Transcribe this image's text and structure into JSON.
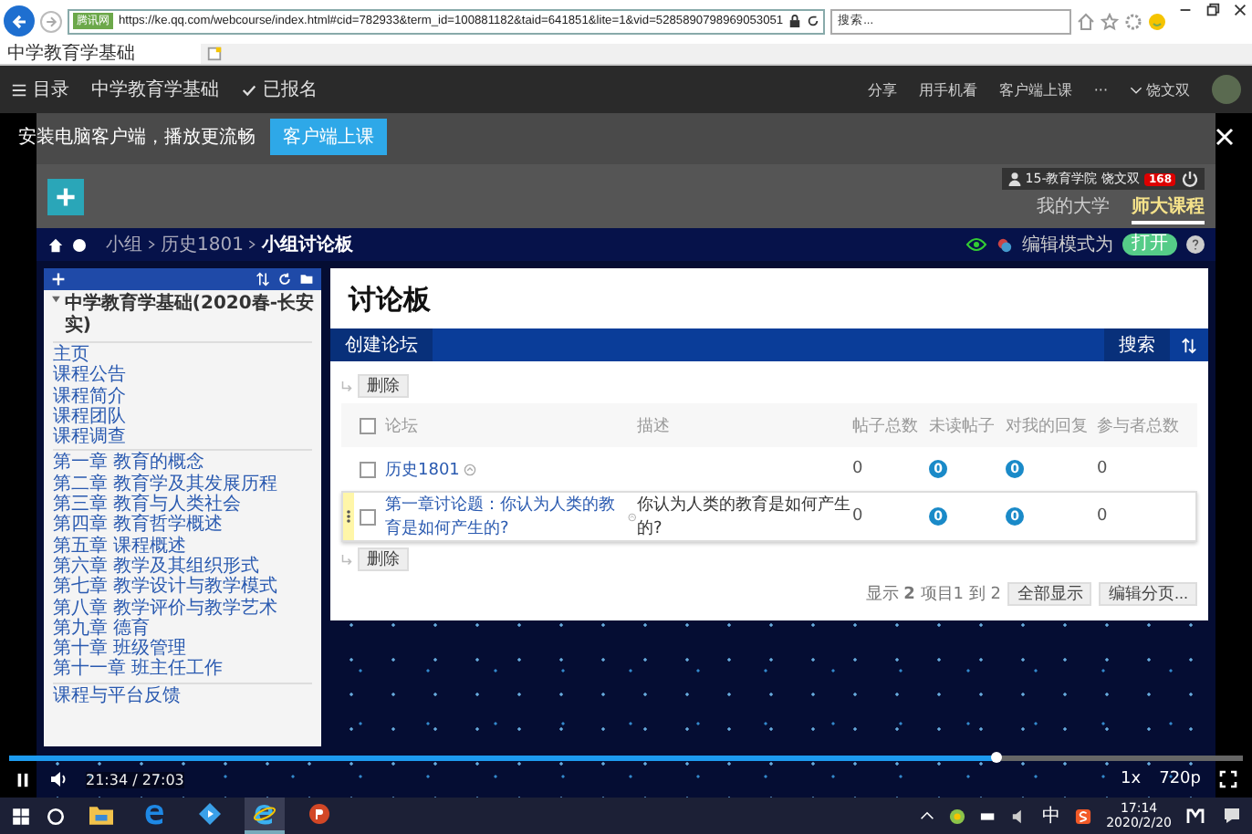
{
  "browser": {
    "url": "https://ke.qq.com/webcourse/index.html#cid=782933&term_id=100881182&taid=641851&lite=1&vid=5285890798969053051",
    "site_tag": "腾讯网",
    "search": {
      "placeholder": "搜索..."
    },
    "tabs": [
      {
        "label": "中学教育学基础",
        "selected": true
      }
    ]
  },
  "site_bar": {
    "menu": "目录",
    "course": "中学教育学基础",
    "enrolled": "已报名",
    "actions": [
      "分享",
      "用手机看",
      "客户端上课",
      "···"
    ],
    "user": "饶文双"
  },
  "banner": {
    "text": "安装电脑客户端，播放更流畅",
    "button": "客户端上课"
  },
  "lms": {
    "user": "15-教育学院 饶文双",
    "badge": "168",
    "tabs": [
      {
        "label": "我的大学",
        "selected": false
      },
      {
        "label": "师大课程",
        "selected": true
      }
    ],
    "breadcrumb": [
      "小组",
      "历史1801",
      "小组讨论板"
    ],
    "edit_mode": {
      "label": "编辑模式为",
      "toggle": "打开",
      "on": true
    },
    "sidebar": {
      "title": "中学教育学基础(2020春-长安实)",
      "groups": [
        [
          "主页",
          "课程公告",
          "课程简介",
          "课程团队",
          "课程调查"
        ],
        [
          "第一章 教育的概念",
          "第二章 教育学及其发展历程",
          "第三章 教育与人类社会",
          "第四章 教育哲学概述",
          "第五章 课程概述",
          "第六章 教学及其组织形式",
          "第七章 教学设计与教学模式",
          "第八章 教学评价与教学艺术",
          "第九章 德育",
          "第十章 班级管理",
          "第十一章 班主任工作"
        ],
        [
          "课程与平台反馈"
        ]
      ]
    },
    "page": {
      "title": "讨论板",
      "create": "创建论坛",
      "search": "搜索",
      "delete_top": "删除",
      "header_checked": false,
      "columns": [
        "论坛",
        "描述",
        "帖子总数",
        "未读帖子",
        "对我的回复",
        "参与者总数"
      ],
      "rows": [
        {
          "forum": "历史1801",
          "posts": "0",
          "unread": "0",
          "replies": "0",
          "participants": "0",
          "checked": false,
          "selected": false
        },
        {
          "forum": "第一章讨论题：你认为人类的教育是如何产生的?",
          "description": "你认为人类的教育是如何产生的?",
          "posts": "0",
          "unread": "0",
          "replies": "0",
          "participants": "0",
          "checked": false,
          "selected": true
        }
      ],
      "delete_bottom": "删除",
      "summary": "显示 **2** 项目1 到 2",
      "show_all": "全部显示",
      "edit_paging": "编辑分页..."
    }
  },
  "player": {
    "time": "21:34 / 27:03",
    "level": 0.8,
    "speed": "1x",
    "quality": "720p"
  },
  "taskbar": {
    "apps": [
      {
        "kind": "folder",
        "selected": false
      },
      {
        "kind": "edge",
        "selected": false
      },
      {
        "kind": "video",
        "selected": false
      },
      {
        "kind": "ie",
        "selected": true
      },
      {
        "kind": "slides",
        "selected": false
      }
    ],
    "ime": "中",
    "time": "17:14",
    "date": "2020/2/20"
  }
}
